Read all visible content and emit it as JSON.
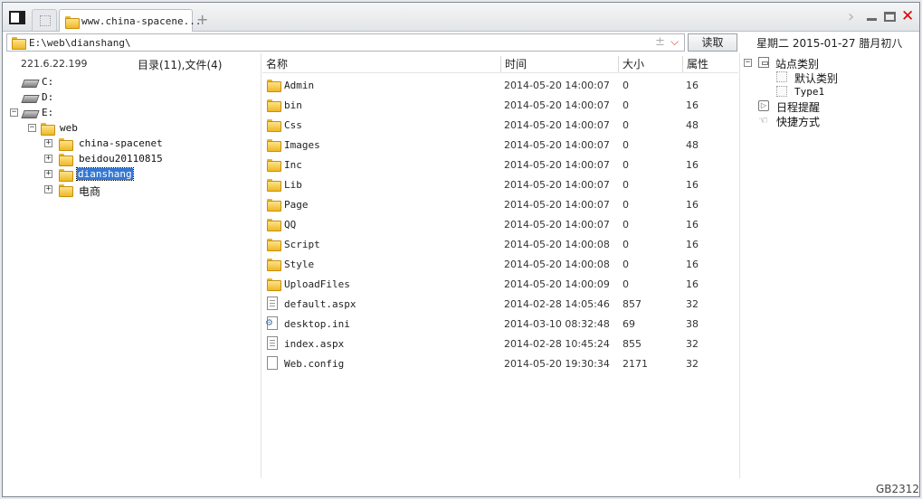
{
  "tabs": {
    "active_label": "www.china-spacene...",
    "add_symbol": "+"
  },
  "window_controls": {
    "nav": "›",
    "close": "✕"
  },
  "address": {
    "value": "E:\\web\\dianshang\\",
    "plus_minus": "±",
    "dropdown": "⌵"
  },
  "read_button": "读取",
  "date_line": "星期二 2015-01-27 腊月初八",
  "left": {
    "ip": "221.6.22.199",
    "count": "目录(11),文件(4)",
    "tree": [
      {
        "label": "C:",
        "type": "drive"
      },
      {
        "label": "D:",
        "type": "drive"
      },
      {
        "label": "E:",
        "type": "drive",
        "expander": "−"
      },
      {
        "label": "web",
        "type": "folder",
        "expander": "−"
      },
      {
        "label": "china-spacenet",
        "type": "folder",
        "expander": "+"
      },
      {
        "label": "beidou20110815",
        "type": "folder",
        "expander": "+"
      },
      {
        "label": "dianshang",
        "type": "folder",
        "expander": "+",
        "selected": true
      },
      {
        "label": "电商",
        "type": "folder",
        "expander": "+"
      }
    ]
  },
  "list": {
    "headers": {
      "name": "名称",
      "time": "时间",
      "size": "大小",
      "attr": "属性"
    },
    "rows": [
      {
        "name": "Admin",
        "time": "2014-05-20 14:00:07",
        "size": "0",
        "attr": "16",
        "icon": "folder-icon"
      },
      {
        "name": "bin",
        "time": "2014-05-20 14:00:07",
        "size": "0",
        "attr": "16",
        "icon": "folder-icon"
      },
      {
        "name": "Css",
        "time": "2014-05-20 14:00:07",
        "size": "0",
        "attr": "48",
        "icon": "folder-icon"
      },
      {
        "name": "Images",
        "time": "2014-05-20 14:00:07",
        "size": "0",
        "attr": "48",
        "icon": "folder-icon"
      },
      {
        "name": "Inc",
        "time": "2014-05-20 14:00:07",
        "size": "0",
        "attr": "16",
        "icon": "folder-icon"
      },
      {
        "name": "Lib",
        "time": "2014-05-20 14:00:07",
        "size": "0",
        "attr": "16",
        "icon": "folder-icon"
      },
      {
        "name": "Page",
        "time": "2014-05-20 14:00:07",
        "size": "0",
        "attr": "16",
        "icon": "folder-icon"
      },
      {
        "name": "QQ",
        "time": "2014-05-20 14:00:07",
        "size": "0",
        "attr": "16",
        "icon": "folder-icon"
      },
      {
        "name": "Script",
        "time": "2014-05-20 14:00:08",
        "size": "0",
        "attr": "16",
        "icon": "folder-icon"
      },
      {
        "name": "Style",
        "time": "2014-05-20 14:00:08",
        "size": "0",
        "attr": "16",
        "icon": "folder-icon"
      },
      {
        "name": "UploadFiles",
        "time": "2014-05-20 14:00:09",
        "size": "0",
        "attr": "16",
        "icon": "folder-icon"
      },
      {
        "name": "default.aspx",
        "time": "2014-02-28 14:05:46",
        "size": "857",
        "attr": "32",
        "icon": "text-file-icon"
      },
      {
        "name": "desktop.ini",
        "time": "2014-03-10 08:32:48",
        "size": "69",
        "attr": "38",
        "icon": "settings-file-icon"
      },
      {
        "name": "index.aspx",
        "time": "2014-02-28 10:45:24",
        "size": "855",
        "attr": "32",
        "icon": "text-file-icon"
      },
      {
        "name": "Web.config",
        "time": "2014-05-20 19:30:34",
        "size": "2171",
        "attr": "32",
        "icon": "blank-file-icon"
      }
    ]
  },
  "right": {
    "site_category": "站点类别",
    "expander": "−",
    "default_category": "默认类别",
    "type1": "Type1",
    "schedule": "日程提醒",
    "shortcut": "快捷方式"
  },
  "status": "GB2312",
  "colors": {
    "selection": "#3478d4",
    "close": "#e00000",
    "folder": "#f0b824"
  }
}
